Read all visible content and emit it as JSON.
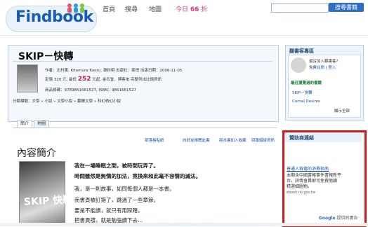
{
  "header": {
    "logo": "Findbook",
    "nav": [
      "首頁",
      "搜尋",
      "地圖"
    ],
    "today_prefix": "今日",
    "today_count": "66",
    "today_suffix": "折",
    "search_button": "搜尋書籍"
  },
  "book": {
    "title": "SKIP－快轉",
    "meta_line1": "作者：北村薰, Kitamura Kaoru, 張秋明  出版社：麥田  出版日期：2008-11-05",
    "price_prefix": "定價 320 元, 最低",
    "price_value": "252",
    "price_suffix": "元起, 金石堂、博客來 完整列出比價資訊",
    "isbn_line": "商品條碼：9789861661527, ISBN：9861661527",
    "tags_line": "分類標籤：文學 » 小說 » 文學小說 » 翻譯文學 » 科幻奇幻小說"
  },
  "tabs": [
    "簡介",
    "地圖"
  ],
  "actions": [
    "部落格貼紙",
    "向好友推薦此書",
    "將本書加入收藏",
    "回報錯誤資訊"
  ],
  "content": {
    "section_title": "內容簡介",
    "cover_text": "SKIP 快轉",
    "intro": [
      "我在一場睡眠之間，被時間玩弄了。",
      "時間雖然是無情的加法，竟換來和此毫不容情的減法。",
      "我，是一則故事，如同每個人都是一本書。",
      "而書頁被訂錯了，跳過了一些章節。",
      "要是不能讀，就只有用踩踏，",
      "把書頁撐，就是勉強讀下去..."
    ]
  },
  "reader": {
    "title": "翻書客專區",
    "question": "還沒加入翻書客?",
    "signup": "免費註冊 | 登入",
    "recent_title": "最近瀏覽過的書籍",
    "recent": [
      "SKIP－快轉",
      "Carnal Desires"
    ],
    "show_all": "顯示全部"
  },
  "ads": {
    "title": "贊助商連結",
    "link": "普通人救擋的消費指南",
    "desc": [
      "本期含中國書報事件書報新平",
      "台，詳情會員即可免費閱讀",
      "精選細圖物。"
    ],
    "url": "ebook.nli.gov.tw",
    "google_brand": "Google",
    "google_suffix": "提供的廣告"
  },
  "colors": {
    "brand_blue": "#1a5cb0",
    "link_blue": "#1a4fa8",
    "price_pink": "#c2185b",
    "highlight_red": "#d11a1a"
  }
}
